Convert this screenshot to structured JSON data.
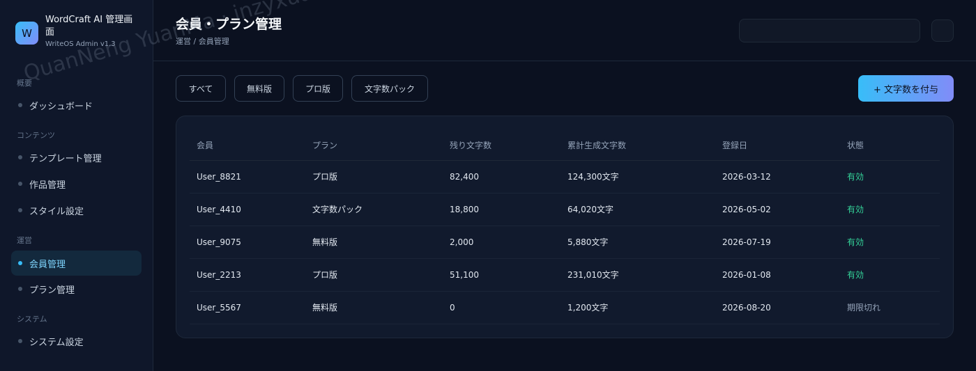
{
  "app": {
    "logo_letter": "W",
    "title": "WordCraft AI 管理画面",
    "subtitle": "WriteOS Admin v1.3"
  },
  "sidebar": {
    "sections": [
      "概要",
      "コンテンツ",
      "運営",
      "システム"
    ],
    "items": [
      {
        "label": "ダッシュボード",
        "section": "概要"
      },
      {
        "label": "テンプレート管理",
        "section": "コンテンツ"
      },
      {
        "label": "作品管理",
        "section": "コンテンツ"
      },
      {
        "label": "スタイル設定",
        "section": "コンテンツ"
      },
      {
        "label": "会員管理",
        "section": "運営",
        "active": true
      },
      {
        "label": "プラン管理",
        "section": "運営"
      },
      {
        "label": "システム設定",
        "section": "システム"
      }
    ]
  },
  "header": {
    "title": "会員・プラン管理",
    "breadcrumb": "運営 / 会員管理",
    "search_placeholder": ""
  },
  "filters": [
    "すべて",
    "無料版",
    "プロ版",
    "文字数パック"
  ],
  "grant_button": "+ 文字数を付与",
  "table": {
    "columns": [
      "会員",
      "プラン",
      "残り文字数",
      "累計生成文字数",
      "登録日",
      "状態"
    ],
    "rows": [
      [
        "User_8821",
        "プロ版",
        "82,400",
        "124,300文字",
        "2026-03-12",
        "有効"
      ],
      [
        "User_4410",
        "文字数パック",
        "18,800",
        "64,020文字",
        "2026-05-02",
        "有効"
      ],
      [
        "User_9075",
        "無料版",
        "2,000",
        "5,880文字",
        "2026-07-19",
        "有効"
      ],
      [
        "User_2213",
        "プロ版",
        "51,100",
        "231,010文字",
        "2026-01-08",
        "有効"
      ],
      [
        "User_5567",
        "無料版",
        "0",
        "1,200文字",
        "2026-08-20",
        "期限切れ"
      ]
    ]
  },
  "watermark": "QuanNeng YuanMa · inzyxuashop.com",
  "colors": {
    "accent": "#38bdf8",
    "accent2": "#818cf8",
    "status_active": "#34d399",
    "status_expired": "#94a3b8",
    "background": "#0b1120"
  }
}
